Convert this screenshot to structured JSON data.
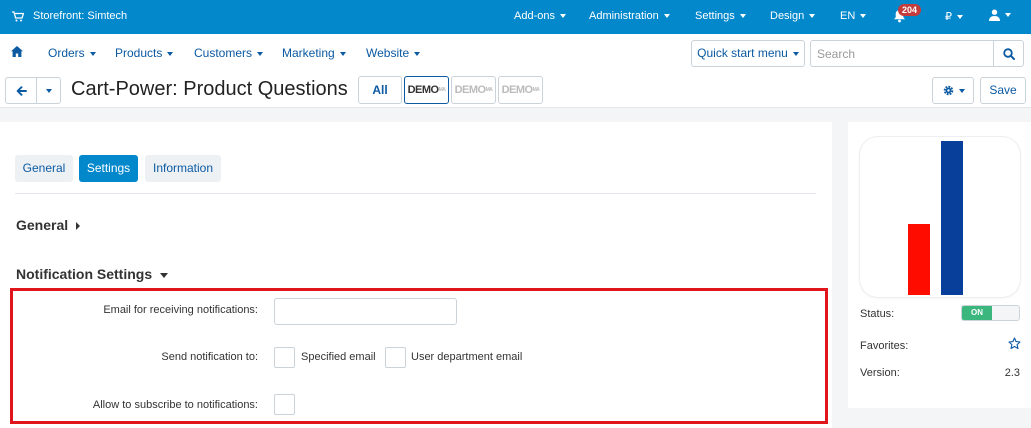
{
  "topbar": {
    "storefront": "Storefront: Simtech",
    "menu": [
      "Add-ons",
      "Administration",
      "Settings",
      "Design",
      "EN"
    ],
    "notification_count": "204",
    "currency": "₽"
  },
  "navbar": {
    "items": [
      "Orders",
      "Products",
      "Customers",
      "Marketing",
      "Website"
    ],
    "quick_start": "Quick start menu",
    "search_placeholder": "Search"
  },
  "titlebar": {
    "title": "Cart-Power: Product Questions",
    "storefront_all": "All",
    "store_logo_text": "DEMO",
    "store_logo_sup": "MA",
    "save_label": "Save"
  },
  "tabs": [
    "General",
    "Settings",
    "Information"
  ],
  "sections": {
    "general": "General",
    "notification": "Notification Settings"
  },
  "fields": {
    "email_label": "Email for receiving notifications:",
    "email_value": "",
    "send_label": "Send notification to:",
    "specified_email": "Specified email",
    "user_department_email": "User department email",
    "subscribe_label": "Allow to subscribe to notifications:"
  },
  "side": {
    "status_label": "Status:",
    "status_value": "ON",
    "favorites_label": "Favorites:",
    "version_label": "Version:",
    "version_value": "2.3"
  },
  "colors": {
    "topbar": "#0388cc",
    "highlight": "#e0161c",
    "toggle_on": "#3bb77e",
    "logo_red": "#ff0c00",
    "logo_blue": "#073f9a"
  }
}
